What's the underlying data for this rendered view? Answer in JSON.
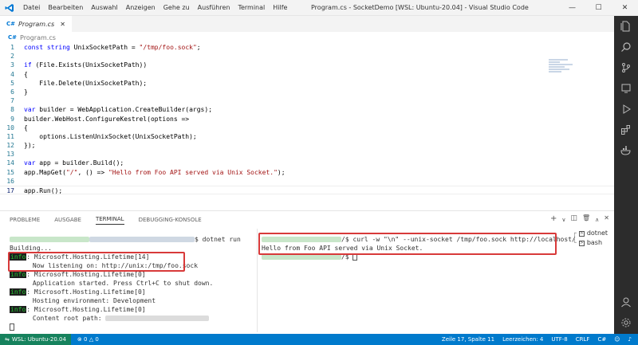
{
  "titlebar": {
    "menu": [
      "Datei",
      "Bearbeiten",
      "Auswahl",
      "Anzeigen",
      "Gehe zu",
      "Ausführen",
      "Terminal",
      "Hilfe"
    ],
    "title": "Program.cs - SocketDemo [WSL: Ubuntu-20.04] - Visual Studio Code"
  },
  "tabs": [
    {
      "label": "Program.cs",
      "lang": "C#"
    }
  ],
  "breadcrumb": {
    "file": "Program.cs"
  },
  "code": [
    {
      "n": "1",
      "t": "const string UnixSocketPath = \"/tmp/foo.sock\";"
    },
    {
      "n": "2",
      "t": ""
    },
    {
      "n": "3",
      "t": "if (File.Exists(UnixSocketPath))"
    },
    {
      "n": "4",
      "t": "{"
    },
    {
      "n": "5",
      "t": "    File.Delete(UnixSocketPath);"
    },
    {
      "n": "6",
      "t": "}"
    },
    {
      "n": "7",
      "t": ""
    },
    {
      "n": "8",
      "t": "var builder = WebApplication.CreateBuilder(args);"
    },
    {
      "n": "9",
      "t": "builder.WebHost.ConfigureKestrel(options =>"
    },
    {
      "n": "10",
      "t": "{"
    },
    {
      "n": "11",
      "t": "    options.ListenUnixSocket(UnixSocketPath);"
    },
    {
      "n": "12",
      "t": "});"
    },
    {
      "n": "13",
      "t": ""
    },
    {
      "n": "14",
      "t": "var app = builder.Build();"
    },
    {
      "n": "15",
      "t": "app.MapGet(\"/\", () => \"Hello from Foo API served via Unix Socket.\");"
    },
    {
      "n": "16",
      "t": ""
    },
    {
      "n": "17",
      "t": "app.Run();"
    }
  ],
  "panel": {
    "tabs": [
      "PROBLEME",
      "AUSGABE",
      "TERMINAL",
      "DEBUGGING-KONSOLE"
    ],
    "active_tab": "TERMINAL",
    "terminals": [
      "dotnet",
      "bash"
    ]
  },
  "terminal_left": {
    "prompt_suffix": "$ dotnet run",
    "lines": [
      {
        "kind": "plain",
        "text": "Building..."
      },
      {
        "kind": "info",
        "text": ": Microsoft.Hosting.Lifetime[14]"
      },
      {
        "kind": "plain",
        "text": "      Now listening on: http://unix:/tmp/foo.sock"
      },
      {
        "kind": "info",
        "text": ": Microsoft.Hosting.Lifetime[0]"
      },
      {
        "kind": "plain",
        "text": "      Application started. Press Ctrl+C to shut down."
      },
      {
        "kind": "info",
        "text": ": Microsoft.Hosting.Lifetime[0]"
      },
      {
        "kind": "plain",
        "text": "      Hosting environment: Development"
      },
      {
        "kind": "info",
        "text": ": Microsoft.Hosting.Lifetime[0]"
      },
      {
        "kind": "plain",
        "text": "      Content root path: "
      }
    ],
    "info_label": "info"
  },
  "terminal_right": {
    "command": "/$ curl -w \"\\n\" --unix-socket /tmp/foo.sock http://localhost/",
    "output": "Hello from Foo API served via Unix Socket.",
    "prompt": "/$ "
  },
  "status": {
    "remote": "WSL: Ubuntu-20.04",
    "errors": "0",
    "warnings": "0",
    "position": "Zeile 17, Spalte 11",
    "indent": "Leerzeichen: 4",
    "encoding": "UTF-8",
    "eol": "CRLF",
    "language": "C#"
  },
  "colors": {
    "accent": "#007acc",
    "remote": "#16825d",
    "highlight_box": "#d83a3a"
  },
  "icons": [
    "vscode-logo-icon",
    "explorer-icon",
    "search-icon",
    "source-control-icon",
    "remote-explorer-icon",
    "run-debug-icon",
    "extensions-icon",
    "docker-icon",
    "account-icon",
    "settings-gear-icon"
  ]
}
